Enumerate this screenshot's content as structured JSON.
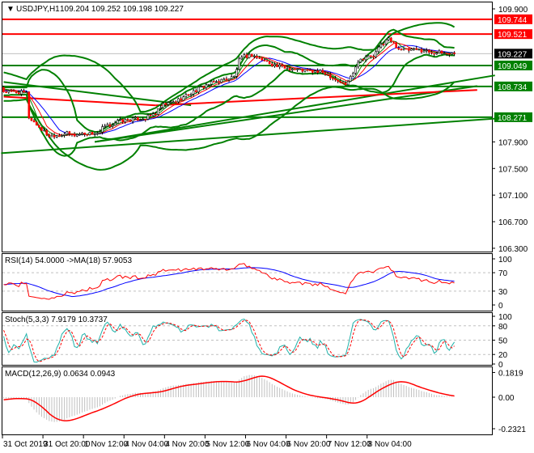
{
  "header": {
    "symbol": "USDJPY,H1",
    "ohlc": "109.204 109.252 109.198 109.227"
  },
  "colors": {
    "bull": "#000000",
    "bear": "#ff0000",
    "level_red": "#ff0000",
    "level_green": "#008000",
    "band": "#008000",
    "rsi": "#ff0000",
    "rsi_ma": "#0000ff",
    "stoch_main": "#20b2aa",
    "stoch_signal": "#ff0000",
    "macd_hist": "#c0c0c0",
    "macd_signal": "#ff0000"
  },
  "chart_data": [
    {
      "type": "candlestick",
      "title": "USDJPY,H1",
      "yaxis_ticks": [
        "109.900",
        "107.900",
        "107.500",
        "107.100",
        "106.700",
        "106.300"
      ],
      "ylim": [
        106.3,
        109.9
      ],
      "price_path": [
        [
          0,
          108.659
        ],
        [
          9,
          108.635
        ],
        [
          10,
          108.27
        ],
        [
          15,
          108.087
        ],
        [
          18,
          107.99
        ],
        [
          25,
          108.027
        ],
        [
          28,
          108.002
        ],
        [
          31,
          108.027
        ],
        [
          38,
          108.027
        ],
        [
          39,
          108.112
        ],
        [
          42,
          108.148
        ],
        [
          45,
          108.209
        ],
        [
          50,
          108.233
        ],
        [
          56,
          108.258
        ],
        [
          60,
          108.331
        ],
        [
          63,
          108.453
        ],
        [
          68,
          108.513
        ],
        [
          74,
          108.635
        ],
        [
          80,
          108.757
        ],
        [
          85,
          108.817
        ],
        [
          91,
          108.878
        ],
        [
          93,
          109.121
        ],
        [
          95,
          109.182
        ],
        [
          98,
          109.207
        ],
        [
          103,
          109.121
        ],
        [
          108,
          109.036
        ],
        [
          114,
          108.999
        ],
        [
          121,
          108.963
        ],
        [
          127,
          108.939
        ],
        [
          132,
          108.817
        ],
        [
          135,
          108.757
        ],
        [
          137,
          108.878
        ],
        [
          140,
          109.121
        ],
        [
          143,
          109.182
        ],
        [
          146,
          109.182
        ],
        [
          149,
          109.365
        ],
        [
          152,
          109.45
        ],
        [
          156,
          109.304
        ],
        [
          159,
          109.28
        ],
        [
          165,
          109.28
        ],
        [
          170,
          109.243
        ],
        [
          178,
          109.227
        ]
      ],
      "levels": [
        {
          "price": 109.744,
          "label": "109.744",
          "color": "#ff0000"
        },
        {
          "price": 109.521,
          "label": "109.521",
          "color": "#ff0000"
        },
        {
          "price": 109.049,
          "label": "109.049",
          "color": "#008000"
        },
        {
          "price": 108.734,
          "label": "108.734",
          "color": "#008000"
        },
        {
          "price": 108.271,
          "label": "108.271",
          "color": "#008000"
        }
      ],
      "current_price": {
        "price": 109.227,
        "label": "109.227"
      },
      "trendlines": [
        {
          "from": [
            -1,
            107.73
          ],
          "to": [
            194,
            108.25
          ],
          "color": "#008000"
        },
        {
          "from": [
            36,
            107.9
          ],
          "to": [
            194,
            108.9
          ],
          "color": "#008000"
        },
        {
          "from": [
            36,
            107.9
          ],
          "to": [
            187,
            108.74
          ],
          "color": "#008000"
        },
        {
          "from": [
            0,
            108.8
          ],
          "to": [
            74,
            108.45
          ],
          "color": "#008000"
        },
        {
          "from": [
            0,
            108.58
          ],
          "to": [
            60,
            108.45
          ],
          "color": "#ff0000"
        },
        {
          "from": [
            60,
            108.45
          ],
          "to": [
            187,
            108.68
          ],
          "color": "#ff0000"
        }
      ]
    },
    {
      "type": "line",
      "title": "RSI(14) 54.0000  ->MA(18) 57.9053",
      "ylim": [
        0,
        100
      ],
      "yaxis_ticks": [
        "100",
        "70",
        "30",
        "0"
      ],
      "levels": [
        70,
        30
      ]
    },
    {
      "type": "line",
      "title": "Stoch(5,3,3) 7.9179 10.3737",
      "ylim": [
        0,
        100
      ],
      "yaxis_ticks": [
        "100",
        "80",
        "50",
        "20",
        "0"
      ],
      "levels": [
        80,
        50,
        20
      ]
    },
    {
      "type": "bar+line",
      "title": "MACD(12,26,9) 0.0634 0.0943",
      "yaxis_ticks": [
        "0.1819",
        "0.00",
        "-0.2321"
      ],
      "ylim": [
        -0.2321,
        0.1819
      ]
    }
  ],
  "xaxis": {
    "labels": [
      "31 Oct 2019",
      "31 Oct 20:00",
      "1 Nov 12:00",
      "4 Nov 04:00",
      "4 Nov 20:00",
      "5 Nov 12:00",
      "6 Nov 04:00",
      "6 Nov 20:00",
      "7 Nov 12:00",
      "8 Nov 04:00"
    ],
    "bars_per_label": 16
  }
}
